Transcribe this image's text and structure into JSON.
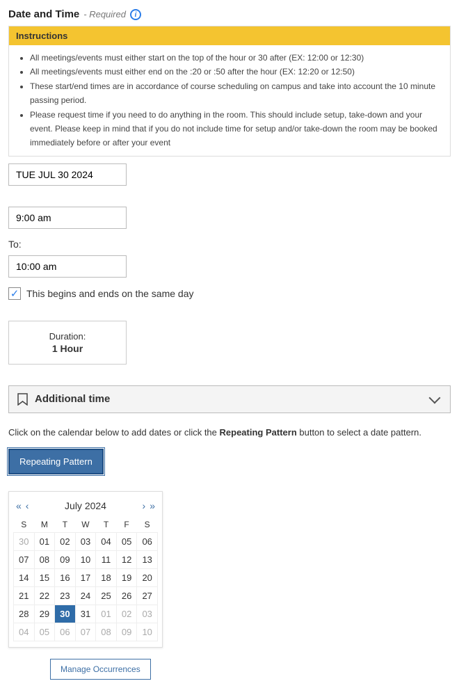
{
  "header": {
    "title": "Date and Time",
    "required": "- Required"
  },
  "instructions": {
    "header": "Instructions",
    "items": [
      "All meetings/events must either start on the top of the hour or 30 after (EX: 12:00 or 12:30)",
      "All meetings/events must either end on the :20 or :50 after the hour (EX: 12:20 or 12:50)",
      "These start/end times are in accordance of course scheduling on campus and take into account the 10 minute passing period.",
      "Please request time if you need to do anything in the room. This should include setup, take-down and your event. Please keep in mind that if you do not include time for setup and/or take-down the room may be booked immediately before or after your event"
    ]
  },
  "date_input": "TUE JUL 30 2024",
  "start_time": "9:00 am",
  "to_label": "To:",
  "end_time": "10:00 am",
  "same_day_label": "This begins and ends on the same day",
  "same_day_checked": true,
  "duration": {
    "label": "Duration:",
    "value": "1 Hour"
  },
  "additional_time_label": "Additional time",
  "hint_pre": "Click on the calendar below to add dates or click the ",
  "hint_bold": "Repeating Pattern",
  "hint_post": " button to select a date pattern.",
  "repeating_btn": "Repeating Pattern",
  "calendar": {
    "title": "July 2024",
    "dow": [
      "S",
      "M",
      "T",
      "W",
      "T",
      "F",
      "S"
    ],
    "weeks": [
      [
        {
          "d": "30",
          "o": true
        },
        {
          "d": "01"
        },
        {
          "d": "02"
        },
        {
          "d": "03"
        },
        {
          "d": "04"
        },
        {
          "d": "05"
        },
        {
          "d": "06"
        }
      ],
      [
        {
          "d": "07"
        },
        {
          "d": "08"
        },
        {
          "d": "09"
        },
        {
          "d": "10"
        },
        {
          "d": "11"
        },
        {
          "d": "12"
        },
        {
          "d": "13"
        }
      ],
      [
        {
          "d": "14"
        },
        {
          "d": "15"
        },
        {
          "d": "16"
        },
        {
          "d": "17"
        },
        {
          "d": "18"
        },
        {
          "d": "19"
        },
        {
          "d": "20"
        }
      ],
      [
        {
          "d": "21"
        },
        {
          "d": "22"
        },
        {
          "d": "23"
        },
        {
          "d": "24"
        },
        {
          "d": "25"
        },
        {
          "d": "26"
        },
        {
          "d": "27"
        }
      ],
      [
        {
          "d": "28"
        },
        {
          "d": "29"
        },
        {
          "d": "30",
          "sel": true
        },
        {
          "d": "31"
        },
        {
          "d": "01",
          "o": true
        },
        {
          "d": "02",
          "o": true
        },
        {
          "d": "03",
          "o": true
        }
      ],
      [
        {
          "d": "04",
          "o": true
        },
        {
          "d": "05",
          "o": true
        },
        {
          "d": "06",
          "o": true
        },
        {
          "d": "07",
          "o": true
        },
        {
          "d": "08",
          "o": true
        },
        {
          "d": "09",
          "o": true
        },
        {
          "d": "10",
          "o": true
        }
      ]
    ]
  },
  "manage_btn": "Manage Occurrences"
}
